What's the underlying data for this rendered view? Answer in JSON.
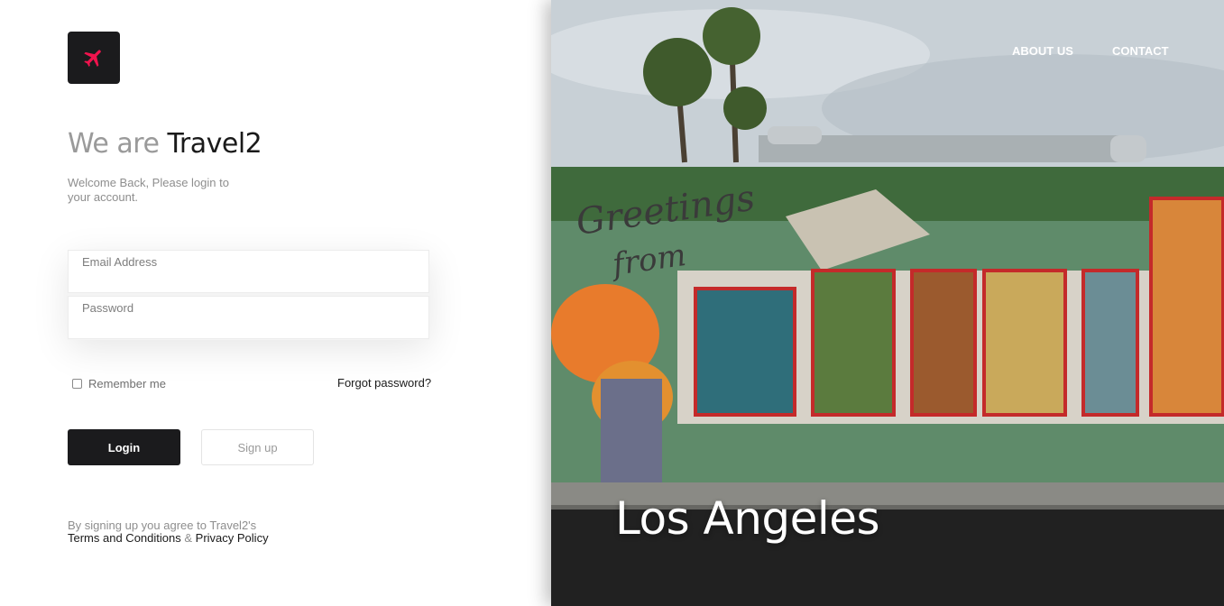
{
  "brand": {
    "logo_icon": "airplane-icon",
    "logo_color": "#f0134d",
    "headline_muted": "We are",
    "headline_brand": "Travel2",
    "welcome": "Welcome Back, Please login to your account."
  },
  "form": {
    "email_label": "Email Address",
    "email_value": "",
    "password_label": "Password",
    "password_value": "",
    "remember_label": "Remember me",
    "remember_checked": false,
    "forgot_label": "Forgot password?",
    "login_label": "Login",
    "signup_label": "Sign up"
  },
  "terms": {
    "prefix": "By signing up you agree to Travel2's",
    "terms_link": "Terms and Conditions",
    "ampersand": "&",
    "privacy_link": "Privacy Policy"
  },
  "hero": {
    "nav": [
      "ABOUT US",
      "CONTACT"
    ],
    "city": "Los Angeles",
    "image_subject": "Greetings from California mural"
  },
  "colors": {
    "dark": "#1b1b1d",
    "accent": "#f0134d",
    "muted": "#9a9a9a"
  }
}
